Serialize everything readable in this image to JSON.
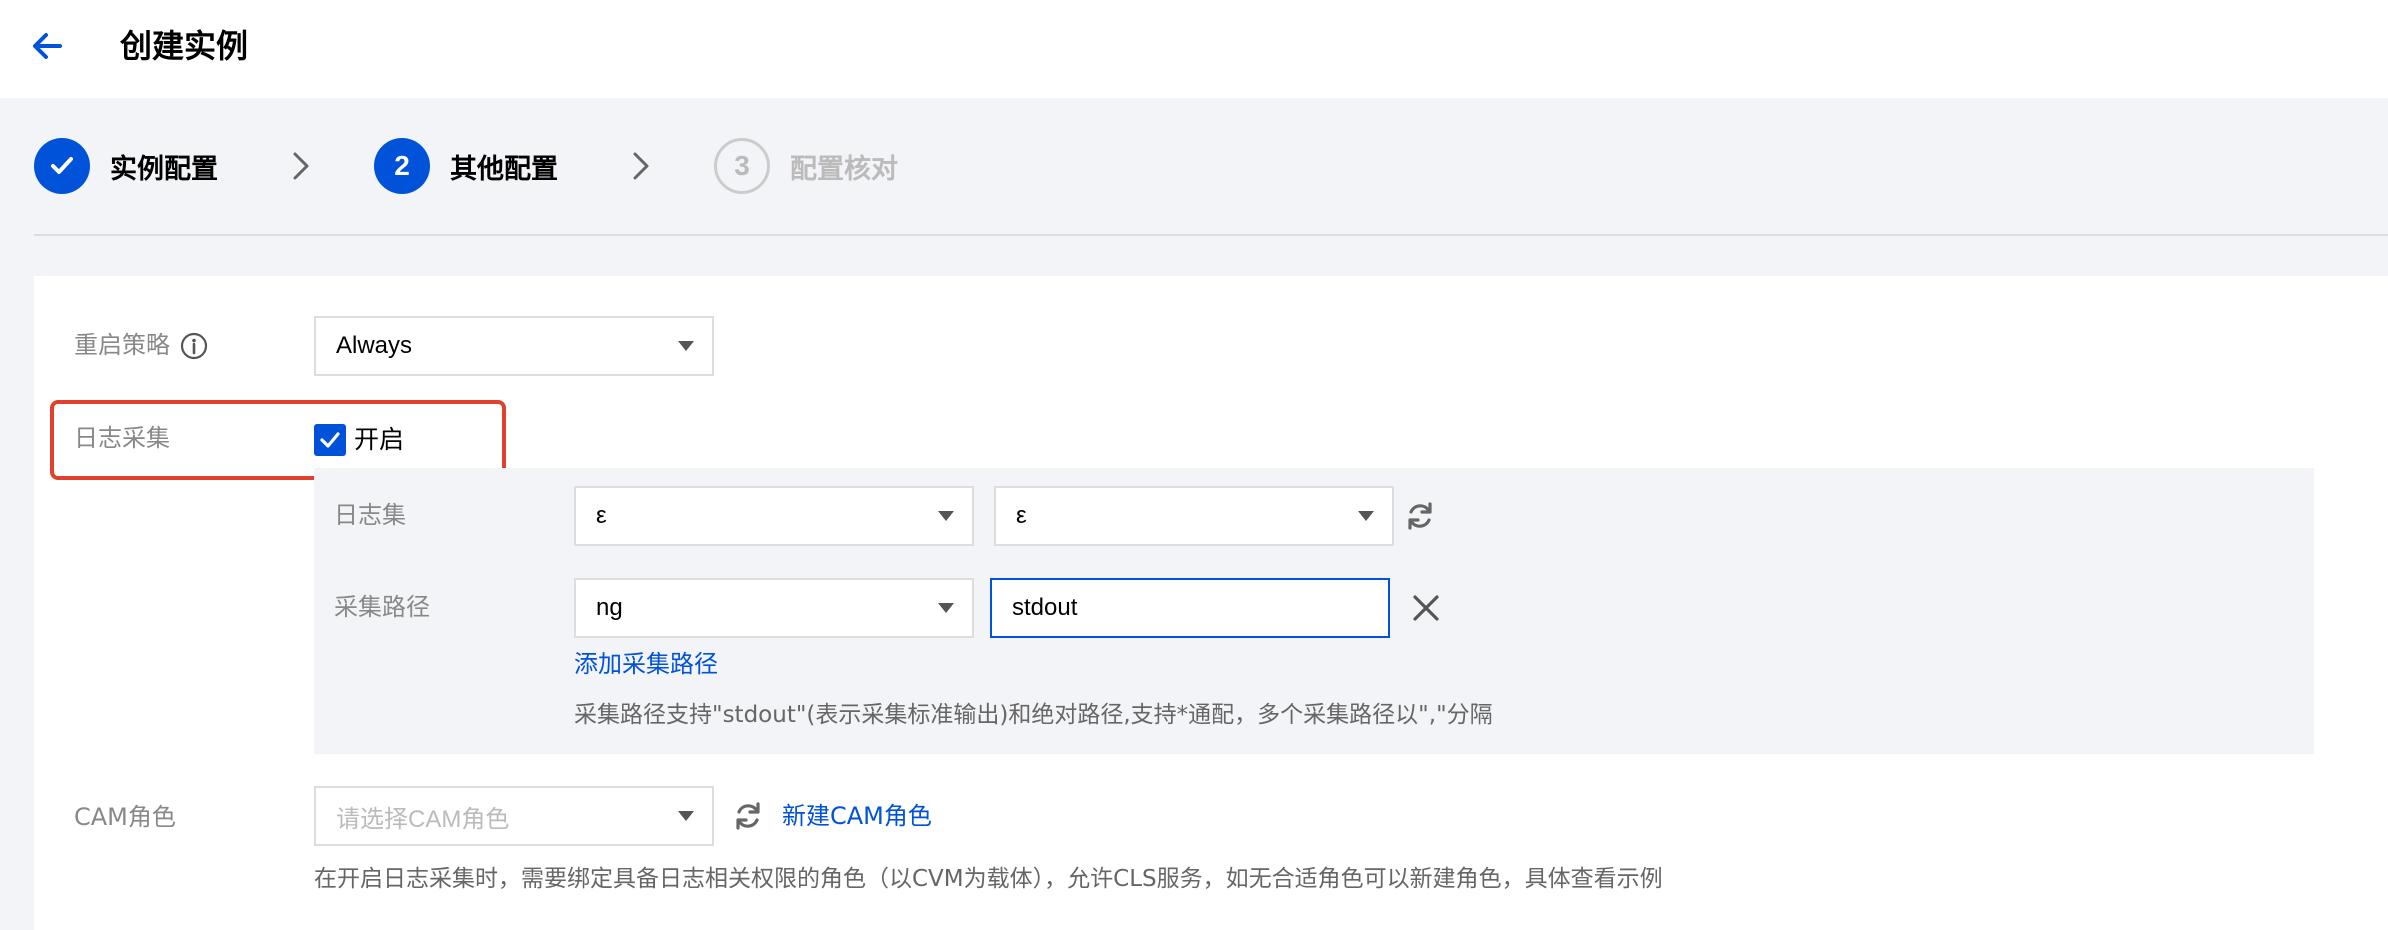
{
  "header": {
    "title": "创建实例"
  },
  "steps": [
    {
      "label": "实例配置",
      "state": "done"
    },
    {
      "number": "2",
      "label": "其他配置",
      "state": "active"
    },
    {
      "number": "3",
      "label": "配置核对",
      "state": "pending"
    }
  ],
  "restart_policy": {
    "label": "重启策略",
    "value": "Always"
  },
  "log_collection": {
    "label": "日志采集",
    "checkbox_label": "开启",
    "checked": true,
    "logset": {
      "label": "日志集",
      "value1": "ε",
      "value2": "ε"
    },
    "path": {
      "label": "采集路径",
      "select_value": "ng",
      "input_value": "stdout",
      "add_link": "添加采集路径",
      "hint": "采集路径支持\"stdout\"(表示采集标准输出)和绝对路径,支持*通配，多个采集路径以\",\"分隔"
    }
  },
  "cam_role": {
    "label": "CAM角色",
    "placeholder": "请选择CAM角色",
    "new_link": "新建CAM角色",
    "hint": "在开启日志采集时，需要绑定具备日志相关权限的角色（以CVM为载体），允许CLS服务，如无合适角色可以新建角色，具体查看示例"
  },
  "colors": {
    "primary": "#0052d9",
    "highlight": "#e2402c"
  }
}
